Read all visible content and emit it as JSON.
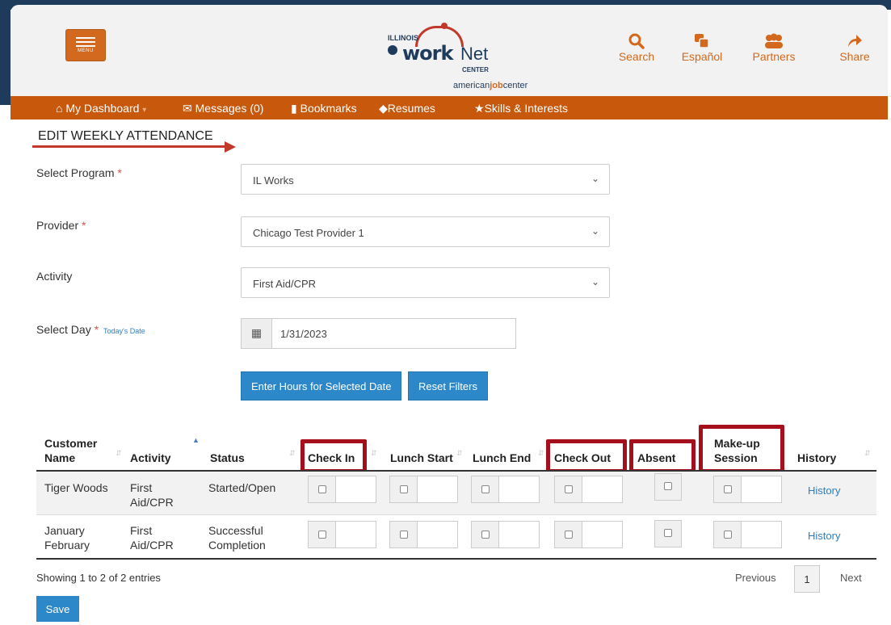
{
  "header": {
    "menu_label": "MENU",
    "logo": {
      "illinois": "ILLINOIS",
      "work": "work",
      "net": "Net",
      "center": "CENTER",
      "ajc_pre": "american",
      "ajc_mid": "job",
      "ajc_post": "center"
    },
    "icons": [
      {
        "icon": "search-icon",
        "label": "Search"
      },
      {
        "icon": "espanol-icon",
        "label": "Español"
      },
      {
        "icon": "partners-icon",
        "label": "Partners"
      },
      {
        "icon": "share-icon",
        "label": "Share"
      }
    ]
  },
  "nav": {
    "dashboard": "My Dashboard",
    "messages": "Messages (0)",
    "bookmarks": "Bookmarks",
    "resumes": "Resumes",
    "skills": "Skills & Interests"
  },
  "page_title": "EDIT WEEKLY ATTENDANCE",
  "form": {
    "program_label": "Select Program",
    "program_value": "IL Works",
    "provider_label": "Provider",
    "provider_value": "Chicago Test Provider 1",
    "activity_label": "Activity",
    "activity_value": "First Aid/CPR",
    "day_label": "Select Day",
    "today_link": "Today's Date",
    "day_value": "1/31/2023",
    "required_mark": "*",
    "enter_hours_button": "Enter Hours for Selected Date",
    "reset_button": "Reset Filters"
  },
  "table": {
    "headers": {
      "customer_name": "Customer Name",
      "activity": "Activity",
      "status": "Status",
      "check_in": "Check In",
      "lunch_start": "Lunch Start",
      "lunch_end": "Lunch End",
      "check_out": "Check Out",
      "absent": "Absent",
      "makeup": "Make-up Session",
      "history": "History"
    },
    "rows": [
      {
        "name": "Tiger Woods",
        "activity": "First Aid/CPR",
        "status": "Started/Open",
        "history": "History"
      },
      {
        "name": "January February",
        "activity": "First Aid/CPR",
        "status": "Successful Completion",
        "history": "History"
      }
    ],
    "showing": "Showing 1 to 2 of 2 entries",
    "prev": "Previous",
    "page": "1",
    "next": "Next"
  },
  "save_button": "Save",
  "colors": {
    "brand_orange": "#c7580c",
    "navy": "#1f3b5c",
    "highlight_red": "#a50e1b",
    "button_blue": "#2d88c9"
  }
}
